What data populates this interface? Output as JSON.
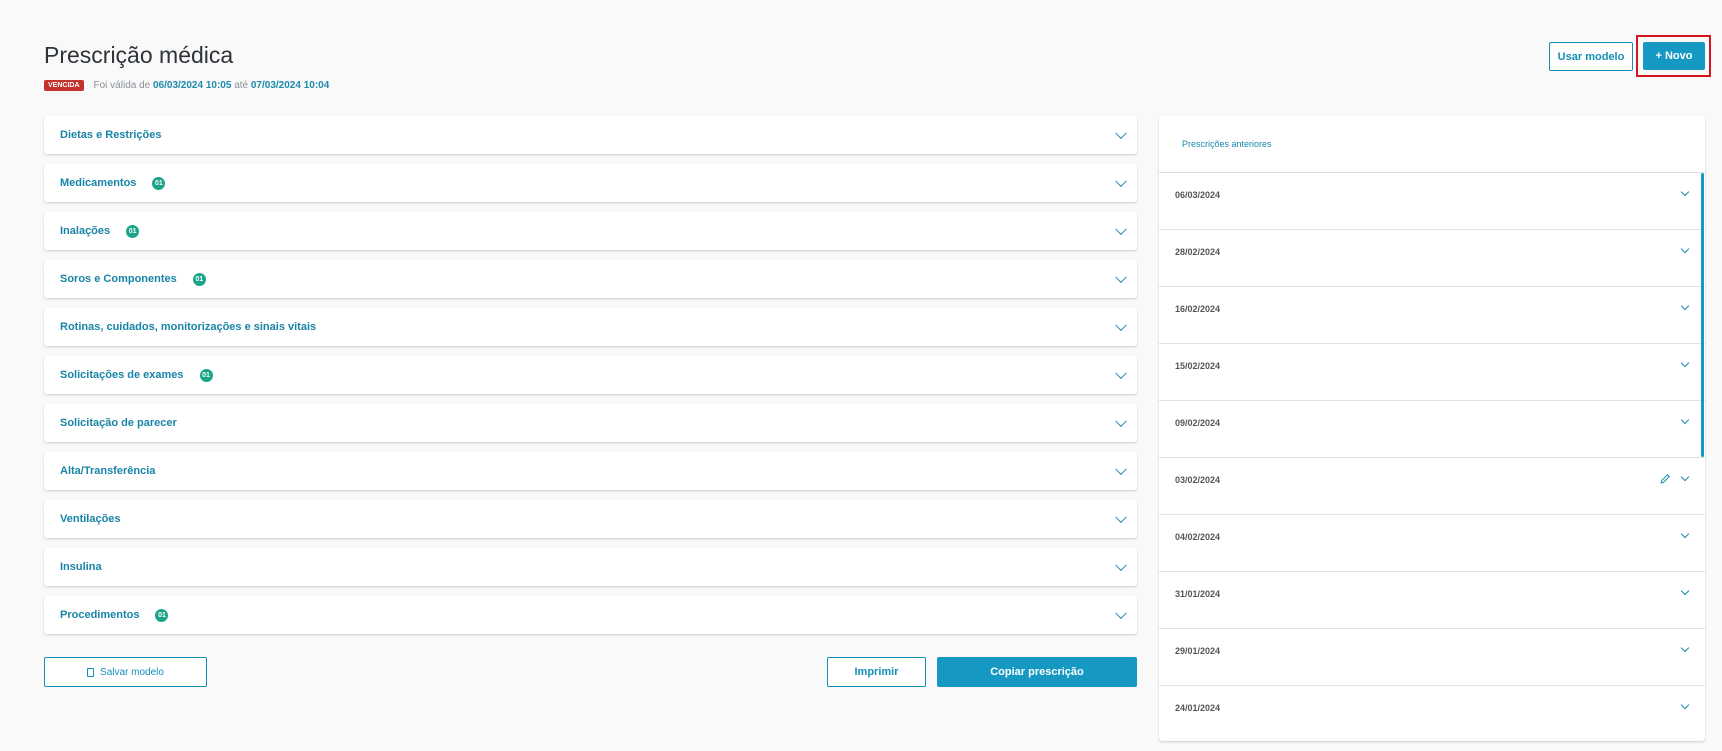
{
  "page": {
    "title": "Prescrição médica",
    "status_badge": "VENCIDA",
    "valid_prefix": "Foi válida de",
    "valid_from": "06/03/2024 10:05",
    "valid_mid": "até",
    "valid_to": "07/03/2024 10:04"
  },
  "header_actions": {
    "use_model_label": "Usar modelo",
    "new_label": "+ Novo"
  },
  "sections": [
    {
      "label": "Dietas e Restrições",
      "count": ""
    },
    {
      "label": "Medicamentos",
      "count": "01"
    },
    {
      "label": "Inalações",
      "count": "01"
    },
    {
      "label": "Soros e Componentes",
      "count": "01"
    },
    {
      "label": "Rotinas, cuidados, monitorizações e sinais vitais",
      "count": ""
    },
    {
      "label": "Solicitações de exames",
      "count": "01"
    },
    {
      "label": "Solicitação de parecer",
      "count": ""
    },
    {
      "label": "Alta/Transferência",
      "count": ""
    },
    {
      "label": "Ventilações",
      "count": ""
    },
    {
      "label": "Insulina",
      "count": ""
    },
    {
      "label": "Procedimentos",
      "count": "01"
    }
  ],
  "footer_actions": {
    "save_model_label": "Salvar modelo",
    "print_label": "Imprimir",
    "copy_label": "Copiar prescrição"
  },
  "history": {
    "title": "Prescrições anteriores",
    "items": [
      {
        "date": "06/03/2024",
        "editable": false
      },
      {
        "date": "28/02/2024",
        "editable": false
      },
      {
        "date": "16/02/2024",
        "editable": false
      },
      {
        "date": "15/02/2024",
        "editable": false
      },
      {
        "date": "09/02/2024",
        "editable": false
      },
      {
        "date": "03/02/2024",
        "editable": true
      },
      {
        "date": "04/02/2024",
        "editable": false
      },
      {
        "date": "31/01/2024",
        "editable": false
      },
      {
        "date": "29/01/2024",
        "editable": false
      },
      {
        "date": "24/01/2024",
        "editable": false
      }
    ]
  },
  "colors": {
    "accent": "#1599c3",
    "expired": "#c5312d",
    "count_badge": "#1ba48b",
    "highlight": "#d5151e"
  },
  "icons": [
    "chevron-down-icon",
    "document-icon",
    "pencil-icon"
  ]
}
